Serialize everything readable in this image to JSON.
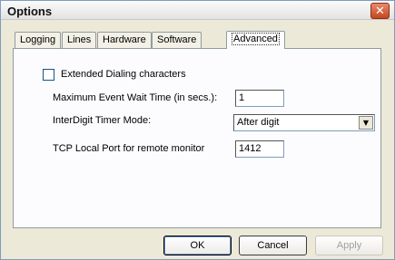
{
  "window": {
    "title": "Options",
    "close_glyph": "✕"
  },
  "tabs": [
    {
      "label": "Logging"
    },
    {
      "label": "Lines"
    },
    {
      "label": "Hardware"
    },
    {
      "label": "Software"
    },
    {
      "label": "Advanced",
      "active": true
    }
  ],
  "advanced": {
    "extended_dialing_label": "Extended Dialing characters",
    "extended_dialing_checked": false,
    "max_wait_label": "Maximum Event Wait Time  (in secs.):",
    "max_wait_value": "1",
    "interdigit_label": "InterDigit Timer Mode:",
    "interdigit_value": "After digit",
    "tcp_port_label": "TCP Local Port for remote monitor",
    "tcp_port_value": "1412"
  },
  "buttons": {
    "ok": "OK",
    "cancel": "Cancel",
    "apply": "Apply"
  }
}
